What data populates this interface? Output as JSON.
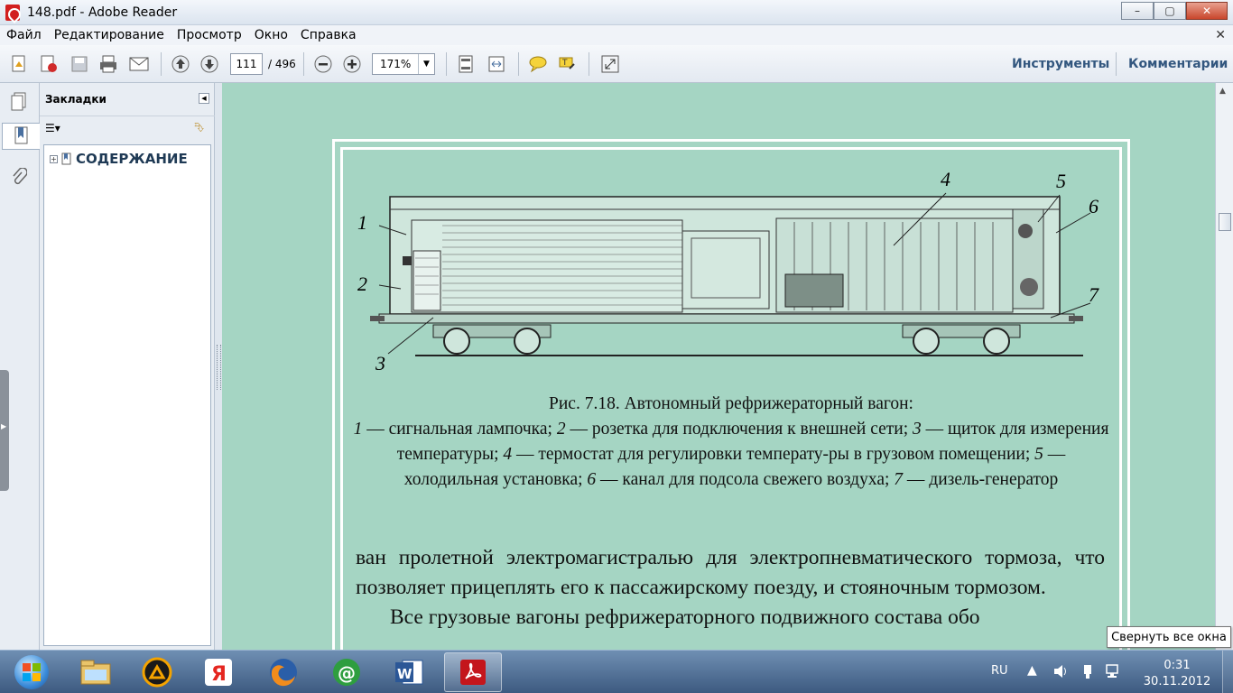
{
  "window": {
    "title": "148.pdf - Adobe Reader",
    "minimize": "–",
    "maximize": "▢",
    "close": "✕"
  },
  "menu": {
    "items": [
      "Файл",
      "Редактирование",
      "Просмотр",
      "Окно",
      "Справка"
    ],
    "close_doc": "✕"
  },
  "toolbar": {
    "page_current": "111",
    "page_total": "/ 496",
    "zoom": "171%",
    "tools_label": "Инструменты",
    "comments_label": "Комментарии"
  },
  "bookmarks": {
    "title": "Закладки",
    "items": [
      {
        "label": "СОДЕРЖАНИЕ",
        "expander": "+"
      }
    ]
  },
  "document": {
    "figure_labels": [
      "1",
      "2",
      "3",
      "4",
      "5",
      "6",
      "7"
    ],
    "caption_title": "Рис. 7.18. Автономный рефрижераторный вагон:",
    "caption_parts": [
      {
        "n": "1",
        "t": " — сигнальная лампочка; "
      },
      {
        "n": "2",
        "t": " — розетка для подключения к внешней сети; "
      },
      {
        "n": "3",
        "t": " — щиток для измерения температуры; "
      },
      {
        "n": "4",
        "t": " — термостат для регулировки температу-ры в грузовом помещении; "
      },
      {
        "n": "5",
        "t": " — холодильная установка; "
      },
      {
        "n": "6",
        "t": " — канал для подсола свежего воздуха; "
      },
      {
        "n": "7",
        "t": " — дизель-генератор"
      }
    ],
    "body_p1": "ван пролетной электромагистралью для электропневматического тормоза, что позволяет прицеплять его к пассажирскому поезду, и стояночным тормозом.",
    "body_p2": "Все грузовые вагоны рефрижераторного подвижного состава обо"
  },
  "tooltip": "Свернуть все окна",
  "taskbar": {
    "apps": [
      "explorer",
      "aimp",
      "yandex",
      "firefox",
      "mail-agent",
      "word",
      "adobe-reader"
    ],
    "language": "RU",
    "time": "0:31",
    "date": "30.11.2012"
  },
  "colors": {
    "page_bg": "#a5d5c3",
    "accent_link": "#33577f"
  }
}
